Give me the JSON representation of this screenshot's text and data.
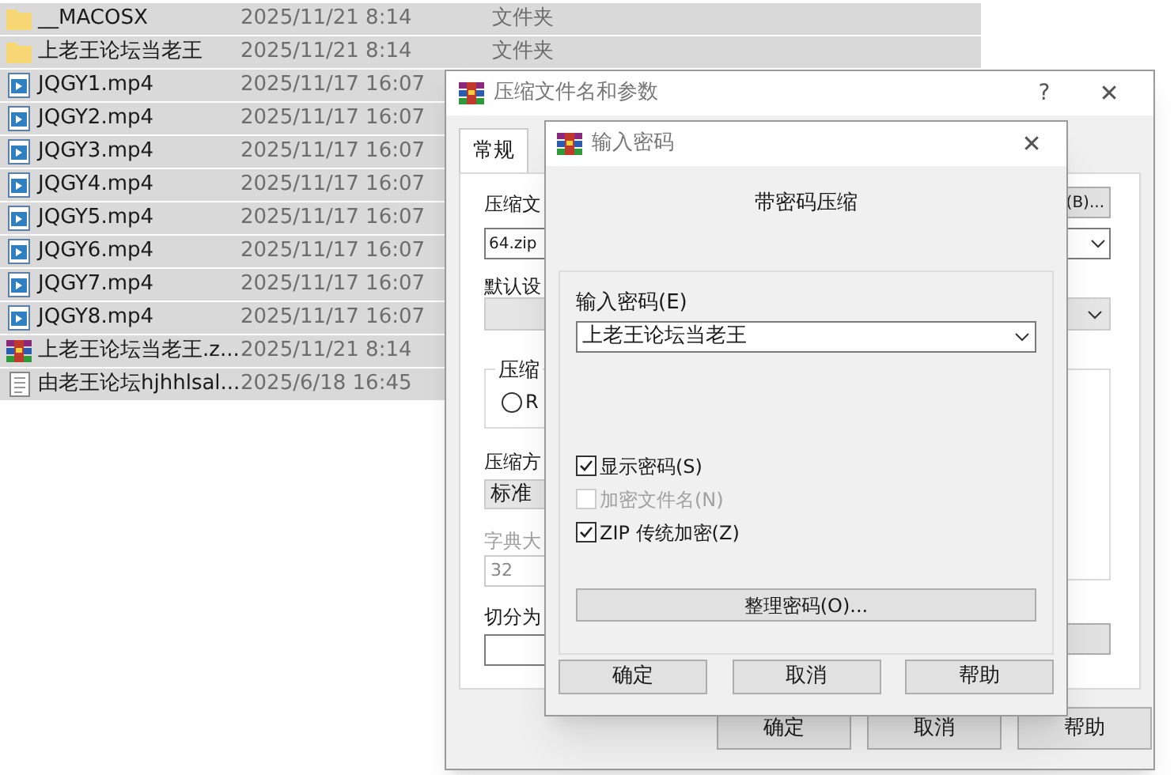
{
  "explorer": {
    "rows": [
      {
        "kind": "folder",
        "name": "__MACOSX",
        "date": "2025/11/21 8:14",
        "type": "文件夹",
        "selected": true
      },
      {
        "kind": "folder",
        "name": "上老王论坛当老王",
        "date": "2025/11/21 8:14",
        "type": "文件夹",
        "selected": true
      },
      {
        "kind": "video",
        "name": "JQGY1.mp4",
        "date": "2025/11/17 16:07",
        "selected": true
      },
      {
        "kind": "video",
        "name": "JQGY2.mp4",
        "date": "2025/11/17 16:07",
        "selected": true
      },
      {
        "kind": "video",
        "name": "JQGY3.mp4",
        "date": "2025/11/17 16:07",
        "selected": true
      },
      {
        "kind": "video",
        "name": "JQGY4.mp4",
        "date": "2025/11/17 16:07",
        "selected": true
      },
      {
        "kind": "video",
        "name": "JQGY5.mp4",
        "date": "2025/11/17 16:07",
        "selected": true
      },
      {
        "kind": "video",
        "name": "JQGY6.mp4",
        "date": "2025/11/17 16:07",
        "selected": true
      },
      {
        "kind": "video",
        "name": "JQGY7.mp4",
        "date": "2025/11/17 16:07",
        "selected": true
      },
      {
        "kind": "video",
        "name": "JQGY8.mp4",
        "date": "2025/11/17 16:07",
        "selected": true
      },
      {
        "kind": "archive",
        "name": "上老王论坛当老王.z...",
        "date": "2025/11/21 8:14",
        "selected": true
      },
      {
        "kind": "text",
        "name": "由老王论坛hjhhlsal...",
        "date": "2025/6/18 16:45",
        "selected": true
      }
    ]
  },
  "archive_dialog": {
    "title": "压缩文件名和参数",
    "help": "?",
    "close": "✕",
    "tabs": [
      {
        "label": "常规",
        "selected": true
      }
    ],
    "archive_name_label": "压缩文",
    "browse_button": "(B)...",
    "archive_name": "64.zip",
    "profile_label": "默认设",
    "format_group": {
      "legend": "压缩",
      "radio": {
        "label": "R",
        "selected": false
      }
    },
    "method_label": "压缩方",
    "method": "标准",
    "dictionary_label": "字典大",
    "dictionary": "32",
    "dictionary_disabled": true,
    "split_label": "切分为",
    "buttons": [
      "确定",
      "取消",
      "帮助"
    ]
  },
  "password_dialog": {
    "title": "输入密码",
    "close": "✕",
    "heading": "带密码压缩",
    "password_label": "输入密码(E)",
    "password": "上老王论坛当老王",
    "options": [
      {
        "label": "显示密码(S)",
        "checked": true,
        "disabled": false
      },
      {
        "label": "加密文件名(N)",
        "checked": false,
        "disabled": true
      },
      {
        "label": "ZIP 传统加密(Z)",
        "checked": true,
        "disabled": false
      }
    ],
    "organize_button": "整理密码(O)...",
    "buttons": [
      "确定",
      "取消",
      "帮助"
    ]
  }
}
